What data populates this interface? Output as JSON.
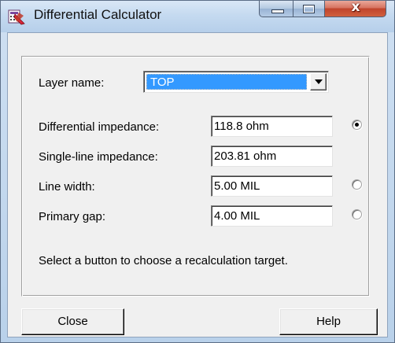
{
  "window": {
    "title": "Differential Calculator",
    "close_glyph": "x"
  },
  "icons": {
    "app": "differential-calculator-icon",
    "minimize": "minimize-icon",
    "maximize": "maximize-icon",
    "close": "close-icon",
    "dropdown": "chevron-down-icon"
  },
  "form": {
    "layer_label": "Layer name:",
    "layer_value": "TOP",
    "rows": [
      {
        "label": "Differential impedance:",
        "value": "118.8 ohm",
        "radio": "checked"
      },
      {
        "label": "Single-line impedance:",
        "value": "203.81 ohm",
        "radio": "none"
      },
      {
        "label": "Line width:",
        "value": "5.00 MIL",
        "radio": "unchecked"
      },
      {
        "label": "Primary gap:",
        "value": "4.00 MIL",
        "radio": "unchecked"
      }
    ],
    "hint": "Select a button to choose a recalculation target."
  },
  "buttons": {
    "close": "Close",
    "help": "Help"
  },
  "colors": {
    "selection": "#3399ff",
    "close_button": "#c0452c",
    "titlebar": "#c5daf0"
  }
}
